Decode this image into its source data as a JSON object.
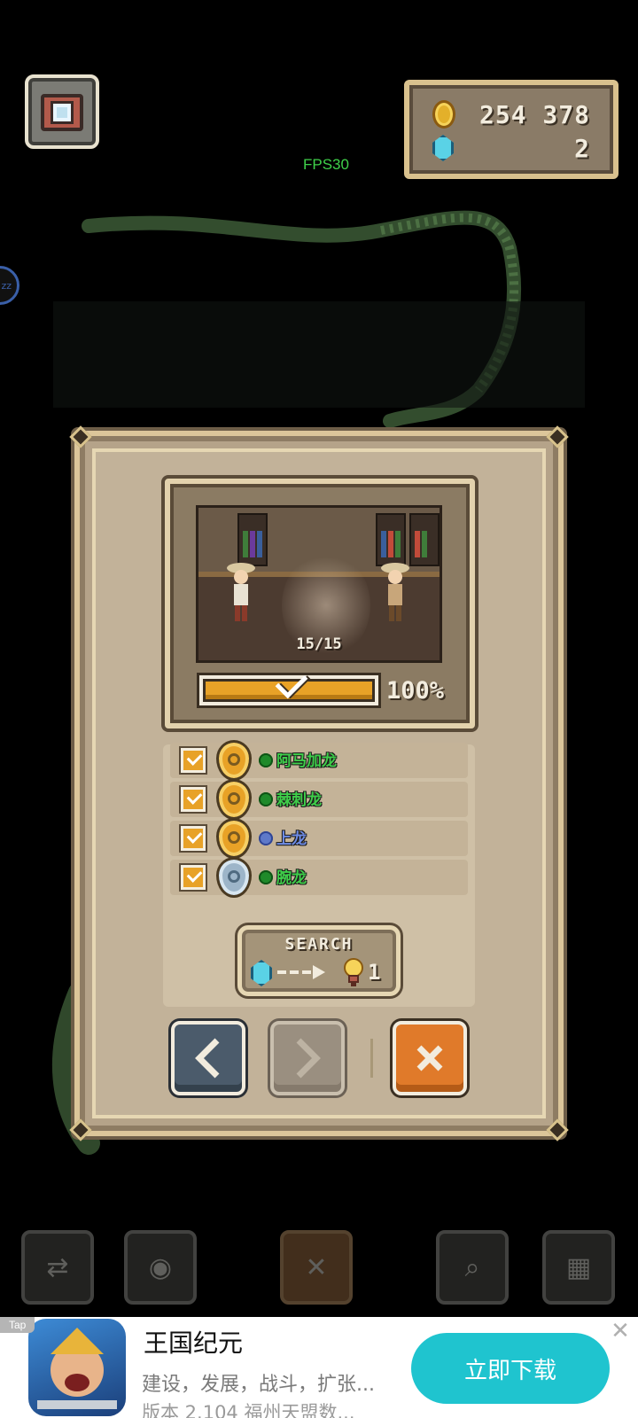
{
  "hud": {
    "gold": "254 378",
    "gems": "2",
    "fps": "FPS30",
    "side_badge": "zz"
  },
  "panel": {
    "progress_count": "15/15",
    "progress_percent": "100%",
    "progress_fraction": 1.0,
    "dinosaurs": [
      {
        "name": "阿马加龙",
        "medal": "gold",
        "dot": "green"
      },
      {
        "name": "棘刺龙",
        "medal": "gold",
        "dot": "green"
      },
      {
        "name": "上龙",
        "medal": "gold",
        "dot": "blue"
      },
      {
        "name": "腕龙",
        "medal": "silver",
        "dot": "green"
      }
    ],
    "search": {
      "label": "SEARCH",
      "cost": "1"
    },
    "nav": {
      "prev_icon": "‹",
      "next_icon": "›",
      "close_icon": "✕"
    }
  },
  "toolbar": {
    "items": [
      "swap-icon",
      "lightbulb-icon",
      "close-icon",
      "magnifier-icon",
      "map-icon"
    ]
  },
  "ad": {
    "tag": "Tap",
    "title": "王国纪元",
    "description": "建设，发展，战斗，扩张...",
    "meta": "版本 2.104   福州天盟数...",
    "cta": "立即下载",
    "close": "✕"
  },
  "colors": {
    "accent_orange": "#e8a227",
    "panel_bg": "#b5a389",
    "ad_cta": "#1fc4cf",
    "name_green": "#3fce4a",
    "name_blue": "#6e8ce6"
  }
}
